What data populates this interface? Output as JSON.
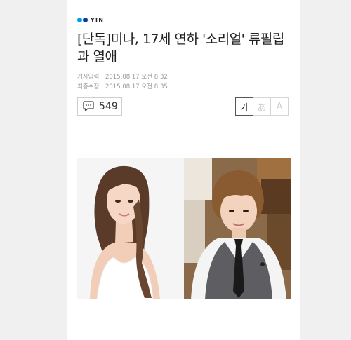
{
  "brand": {
    "name": "YTN"
  },
  "article": {
    "title": "[단독]미나, 17세 연하 '소리얼' 류필립과 열애",
    "published_label": "기사입력",
    "published_value": "2015.08.17 오전 8:32",
    "updated_label": "최종수정",
    "updated_value": "2015.08.17 오전 8:35"
  },
  "comments": {
    "count": "549",
    "icon": "speech-bubble-icon"
  },
  "font_size_controls": [
    {
      "label": "가",
      "active": true
    },
    {
      "label": "あ",
      "active": false
    },
    {
      "label": "A",
      "active": false
    }
  ],
  "colors": {
    "background": "#f0f0f0",
    "page": "#ffffff",
    "brand_light": "#00a0e9",
    "brand_dark": "#0a3d91",
    "meta_text": "#9a9a9a"
  }
}
